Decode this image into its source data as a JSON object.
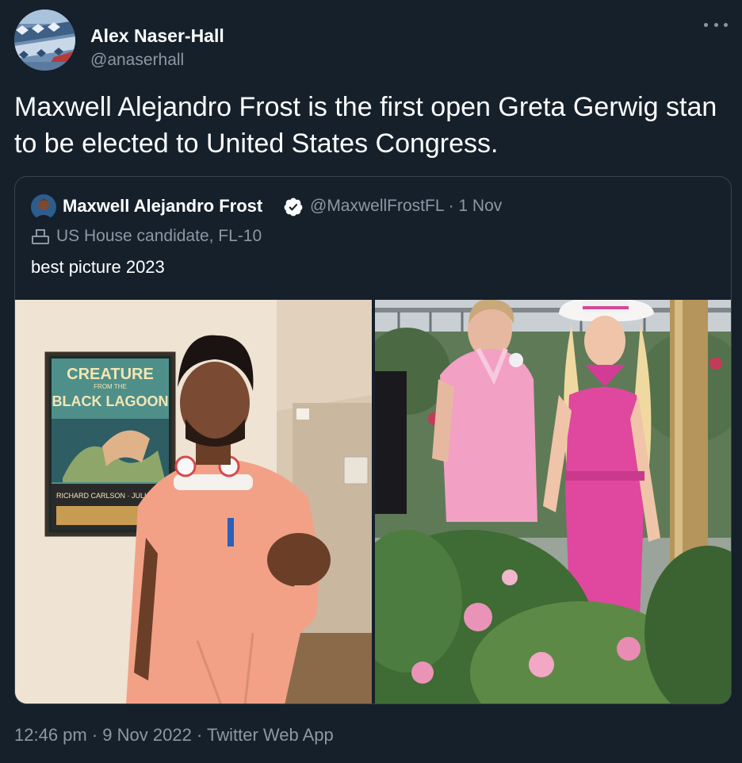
{
  "author": {
    "name": "Alex Naser-Hall",
    "handle": "@anaserhall"
  },
  "tweet": {
    "text": "Maxwell Alejandro Frost is the first open Greta Gerwig stan to be elected to United States Congress."
  },
  "quoted_tweet": {
    "name": "Maxwell Alejandro Frost",
    "handle_date": "@MaxwellFrostFL · 1 Nov",
    "candidate_label": "US House candidate, FL-10",
    "text": "best picture 2023",
    "poster_line1": "CREATURE",
    "poster_line2": "FROM THE",
    "poster_line3": "BLACK LAGOON",
    "poster_credits": "RICHARD CARLSON · JULIA A"
  },
  "footer": {
    "time": "12:46 pm",
    "sep1": " · ",
    "date": "9 Nov 2022",
    "sep2": " · ",
    "source": "Twitter Web App"
  },
  "colors": {
    "background": "#15202b",
    "secondary_text": "#8b98a5",
    "border": "#38444d",
    "verified": "#ffffff"
  }
}
